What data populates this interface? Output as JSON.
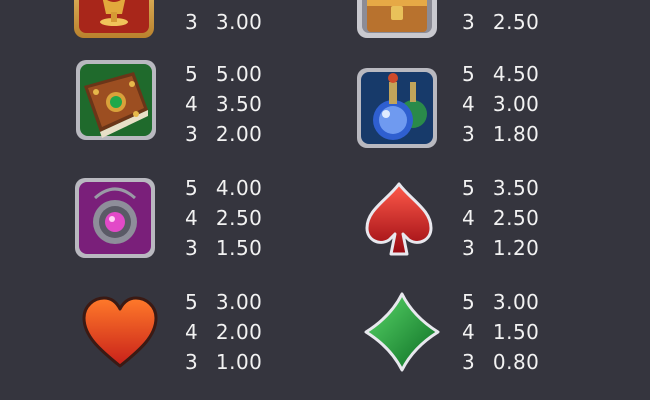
{
  "paytable": {
    "rows": [
      {
        "left": {
          "symbol": "golden-chalice-icon",
          "pays": [
            {
              "count": "3",
              "value": "3.00"
            }
          ]
        },
        "right": {
          "symbol": "treasure-chest-icon",
          "pays": [
            {
              "count": "3",
              "value": "2.50"
            }
          ]
        }
      },
      {
        "left": {
          "symbol": "spell-book-icon",
          "pays": [
            {
              "count": "5",
              "value": "5.00"
            },
            {
              "count": "4",
              "value": "3.50"
            },
            {
              "count": "3",
              "value": "2.00"
            }
          ]
        },
        "right": {
          "symbol": "potion-bottles-icon",
          "pays": [
            {
              "count": "5",
              "value": "4.50"
            },
            {
              "count": "4",
              "value": "3.00"
            },
            {
              "count": "3",
              "value": "1.80"
            }
          ]
        }
      },
      {
        "left": {
          "symbol": "amulet-icon",
          "pays": [
            {
              "count": "5",
              "value": "4.00"
            },
            {
              "count": "4",
              "value": "2.50"
            },
            {
              "count": "3",
              "value": "1.50"
            }
          ]
        },
        "right": {
          "symbol": "spade-icon",
          "pays": [
            {
              "count": "5",
              "value": "3.50"
            },
            {
              "count": "4",
              "value": "2.50"
            },
            {
              "count": "3",
              "value": "1.20"
            }
          ]
        }
      },
      {
        "left": {
          "symbol": "heart-icon",
          "pays": [
            {
              "count": "5",
              "value": "3.00"
            },
            {
              "count": "4",
              "value": "2.00"
            },
            {
              "count": "3",
              "value": "1.00"
            }
          ]
        },
        "right": {
          "symbol": "diamond-icon",
          "pays": [
            {
              "count": "5",
              "value": "3.00"
            },
            {
              "count": "4",
              "value": "1.50"
            },
            {
              "count": "3",
              "value": "0.80"
            }
          ]
        }
      }
    ]
  },
  "colors": {
    "background": "#35353e",
    "text": "#f2f2f2",
    "spade": "#c8161d",
    "heart": "#e8401a",
    "diamond": "#1f9a3a"
  }
}
